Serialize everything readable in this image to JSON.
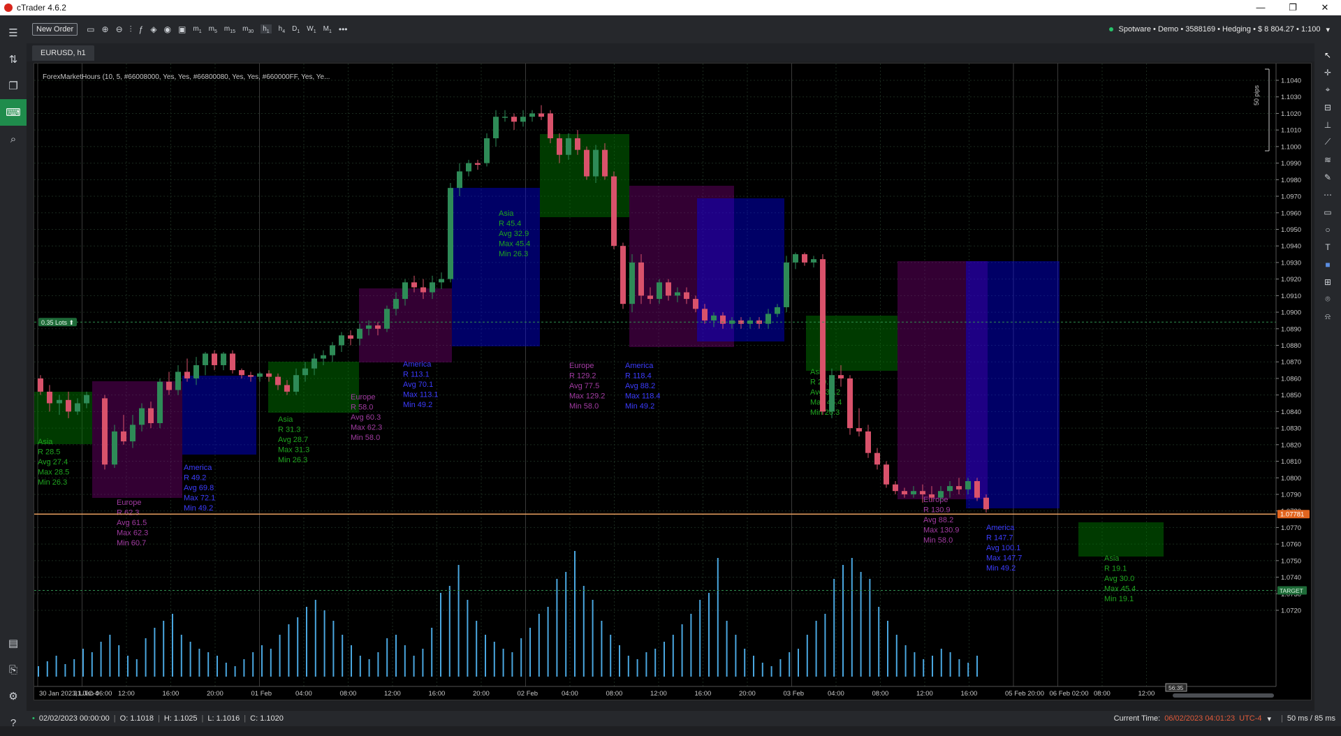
{
  "app": {
    "title": "cTrader 4.6.2",
    "window_buttons": [
      "—",
      "❐",
      "✕"
    ]
  },
  "left_nav": {
    "top_items": [
      {
        "name": "trade-icon"
      },
      {
        "name": "copy-icon"
      },
      {
        "name": "automate-icon",
        "active": true
      },
      {
        "name": "analyze-icon"
      }
    ],
    "bottom_items": [
      {
        "name": "store-icon"
      },
      {
        "name": "copy-trade-icon"
      },
      {
        "name": "settings-icon"
      },
      {
        "name": "help-icon"
      }
    ]
  },
  "toolbar": {
    "new_order_label": "New Order",
    "timeframes": [
      {
        "label": "m",
        "sub": "1"
      },
      {
        "label": "m",
        "sub": "5"
      },
      {
        "label": "m",
        "sub": "15"
      },
      {
        "label": "m",
        "sub": "30"
      },
      {
        "label": "h",
        "sub": "1",
        "active": true
      },
      {
        "label": "h",
        "sub": "4"
      },
      {
        "label": "D",
        "sub": "1"
      },
      {
        "label": "W",
        "sub": "1"
      },
      {
        "label": "M",
        "sub": "1"
      }
    ],
    "more": "•••",
    "account": "Spotware • Demo • 3588169 • Hedging • $ 8 804.27 • 1:100"
  },
  "tab": {
    "label": "EURUSD, h1"
  },
  "chart": {
    "indicator_label": "ForexMarketHours (10, 5, #66008000, Yes, Yes, #66800080, Yes, Yes, #660000FF, Yes, Ye...",
    "pips_label": "50 pips",
    "lots_label": "0.35 Lots ⬆",
    "price_label": "1.07781",
    "target_label": "TARGET",
    "hover_label": "56:35",
    "price_ticks": [
      "1.1040",
      "1.1030",
      "1.1020",
      "1.1010",
      "1.1000",
      "1.0990",
      "1.0980",
      "1.0970",
      "1.0960",
      "1.0950",
      "1.0940",
      "1.0930",
      "1.0920",
      "1.0910",
      "1.0900",
      "1.0890",
      "1.0880",
      "1.0870",
      "1.0860",
      "1.0850",
      "1.0840",
      "1.0830",
      "1.0820",
      "1.0810",
      "1.0800",
      "1.0790",
      "1.0780",
      "1.0770",
      "1.0760",
      "1.0750",
      "1.0740",
      "1.0730",
      "1.0720"
    ],
    "time_ticks": [
      "30 Jan 2023, UTC-4",
      "31 Jan 06:00",
      "12:00",
      "16:00",
      "20:00",
      "01 Feb",
      "04:00",
      "08:00",
      "12:00",
      "16:00",
      "20:00",
      "02 Feb",
      "04:00",
      "08:00",
      "12:00",
      "16:00",
      "20:00",
      "03 Feb",
      "04:00",
      "08:00",
      "12:00",
      "16:00",
      "05 Feb 20:00",
      "06 Feb 02:00",
      "08:00",
      "12:00"
    ],
    "sessions": [
      {
        "name": "Asia",
        "lines": [
          "Asia",
          "R 28.5",
          "Avg 27.4",
          "Max 28.5",
          "Min 26.3"
        ],
        "color": "#008000"
      },
      {
        "name": "Europe",
        "lines": [
          "Europe",
          "R 62.3",
          "Avg 61.5",
          "Max 62.3",
          "Min 60.7"
        ],
        "color": "#800080"
      },
      {
        "name": "America",
        "lines": [
          "America",
          "R 49.2",
          "Avg 69.8",
          "Max 72.1",
          "Min 49.2"
        ],
        "color": "#0000FF"
      },
      {
        "name": "Asia",
        "lines": [
          "Asia",
          "R 31.3",
          "Avg 28.7",
          "Max 31.3",
          "Min 26.3"
        ],
        "color": "#008000"
      },
      {
        "name": "Europe",
        "lines": [
          "Europe",
          "R 58.0",
          "Avg 60.3",
          "Max 62.3",
          "Min 58.0"
        ],
        "color": "#800080"
      },
      {
        "name": "America",
        "lines": [
          "America",
          "R 113.1",
          "Avg 70.1",
          "Max 113.1",
          "Min 49.2"
        ],
        "color": "#0000FF"
      },
      {
        "name": "Asia",
        "lines": [
          "Asia",
          "R 45.4",
          "Avg 32.9",
          "Max 45.4",
          "Min 26.3"
        ],
        "color": "#008000"
      },
      {
        "name": "Europe",
        "lines": [
          "Europe",
          "R 129.2",
          "Avg 77.5",
          "Max 129.2",
          "Min 58.0"
        ],
        "color": "#800080"
      },
      {
        "name": "America",
        "lines": [
          "America",
          "R 118.4",
          "Avg 88.2",
          "Max 118.4",
          "Min 49.2"
        ],
        "color": "#0000FF"
      },
      {
        "name": "Asia",
        "lines": [
          "Asia",
          "R 29.6",
          "Avg 32.2",
          "Max 45.4",
          "Min 26.3"
        ],
        "color": "#008000"
      },
      {
        "name": "Europe",
        "lines": [
          "Europe",
          "R 130.9",
          "Avg 88.2",
          "Max 130.9",
          "Min 58.0"
        ],
        "color": "#800080"
      },
      {
        "name": "America",
        "lines": [
          "America",
          "R 147.7",
          "Avg 100.1",
          "Max 147.7",
          "Min 49.2"
        ],
        "color": "#0000FF"
      },
      {
        "name": "Asia",
        "lines": [
          "Asia",
          "R 19.1",
          "Avg 30.0",
          "Max 45.4",
          "Min 19.1"
        ],
        "color": "#008000"
      }
    ],
    "colors": {
      "bull": "#2e8b57",
      "bear": "#d9526b",
      "asia": "#008000",
      "europe": "#800080",
      "america": "#0000ff",
      "volume": "#4aa7e0",
      "price_line": "#e8a060"
    }
  },
  "right_tools": [
    "cursor-icon",
    "crosshair-icon",
    "pin-icon",
    "horizontal-line-icon",
    "vertical-line-icon",
    "trendline-icon",
    "fibonacci-icon",
    "pencil-icon",
    "grid-icon",
    "rectangle-icon",
    "ellipse-icon",
    "text-icon",
    "color-icon",
    "layers-icon",
    "camera-icon",
    "alert-icon"
  ],
  "status": {
    "bar_date": "02/02/2023 00:00:00",
    "open": "O: 1.1018",
    "high": "H: 1.1025",
    "low": "L: 1.1016",
    "close": "C: 1.1020",
    "current_time_label": "Current Time:",
    "current_time": "06/02/2023 04:01:23",
    "timezone": "UTC-4",
    "latency": "50 ms / 85 ms"
  }
}
